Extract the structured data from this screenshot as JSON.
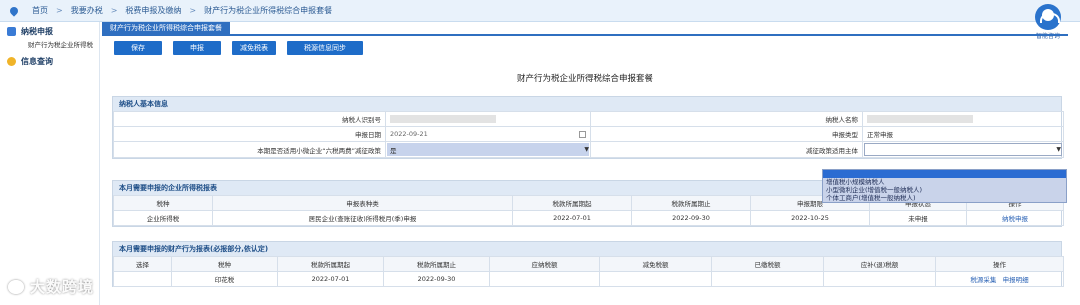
{
  "breadcrumb": [
    "首页",
    "我要办税",
    "税费申报及缴纳",
    "财产行为税企业所得税综合申报套餐"
  ],
  "help": {
    "label": "智能咨询"
  },
  "sidebar": {
    "items": [
      {
        "label": "纳税申报",
        "icon": "grid-icon"
      },
      {
        "label": "财产行为税企业所得税",
        "icon": ""
      },
      {
        "label": "信息查询",
        "icon": "message-icon"
      }
    ]
  },
  "tab": {
    "label": "财产行为税企业所得税综合申报套餐"
  },
  "toolbar": {
    "save": "保存",
    "declare": "申报",
    "reduce": "减免税表",
    "sync": "税源信息同步"
  },
  "page_title": "财产行为税企业所得税综合申报套餐",
  "taxpayer": {
    "section_title": "纳税人基本信息",
    "id_label": "纳税人识别号",
    "name_label": "纳税人名称",
    "date_label": "申报日期",
    "date_value": "2022-09-21",
    "type_label": "申报类型",
    "type_value": "正常申报",
    "policy_label": "本期是否适用小微企业“六税两费”减征政策",
    "policy_value": "是",
    "subject_label": "减征政策适用主体",
    "subject_value": ""
  },
  "dropdown": {
    "options": [
      "",
      "增值税小规模纳税人",
      "小型微利企业(增值税一般纳税人)",
      "个体工商户(增值税一般纳税人)"
    ]
  },
  "cit": {
    "section_title": "本月需要申报的企业所得税报表",
    "headers": [
      "税种",
      "申报表种类",
      "税款所属期起",
      "税款所属期止",
      "申报期限",
      "申报状态",
      "操作"
    ],
    "rows": [
      [
        "企业所得税",
        "居民企业(查账征收)所得税月(季)申报",
        "2022-07-01",
        "2022-09-30",
        "2022-10-25",
        "未申报",
        "纳税申报"
      ]
    ]
  },
  "prop": {
    "section_title": "本月需要申报的财产行为报表(必报部分,依认定)",
    "headers": [
      "选择",
      "税种",
      "税款所属期起",
      "税款所属期止",
      "应纳税额",
      "减免税额",
      "已缴税额",
      "应补(退)税额",
      "操作"
    ],
    "rows": [
      {
        "tax": "印花税",
        "start": "2022-07-01",
        "end": "2022-09-30",
        "action1": "税源采集",
        "action2": "申报明细"
      }
    ]
  },
  "watermark": "大数跨境"
}
